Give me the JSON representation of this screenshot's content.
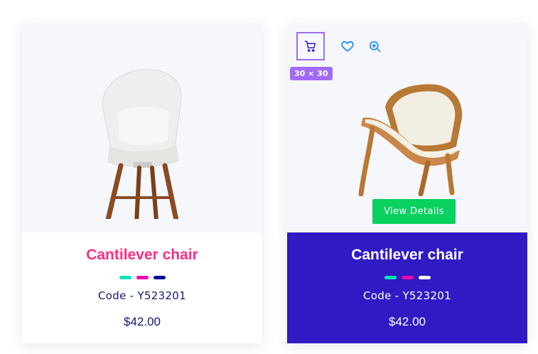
{
  "products": [
    {
      "title": "Cantilever chair",
      "code": "Code - Y523201",
      "price": "$42.00",
      "swatches": [
        "#05e6b7",
        "#f701a8",
        "#00009d"
      ]
    },
    {
      "title": "Cantilever chair",
      "code": "Code - Y523201",
      "price": "$42.00",
      "swatches": [
        "#05e6b7",
        "#f701a8",
        "#ffffff"
      ],
      "actions": {
        "cart_icon": "cart-icon",
        "heart_icon": "heart-icon",
        "zoom_icon": "zoom-in-icon",
        "size_badge": "30 × 30"
      },
      "view_details_label": "View Details"
    }
  ],
  "colors": {
    "title_pink": "#fb2e86",
    "navy": "#151875",
    "highlight_blue": "#2f1ac4",
    "button_green": "#08d15f",
    "badge_purple": "#a26af5"
  }
}
